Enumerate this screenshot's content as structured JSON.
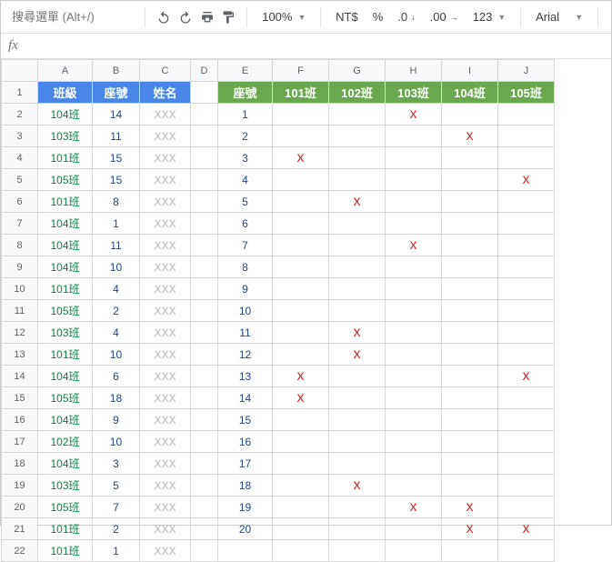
{
  "toolbar": {
    "search_placeholder": "搜尋選單 (Alt+/)",
    "zoom": "100%",
    "currency": "NT$",
    "percent": "%",
    "dec_dec": ".0",
    "dec_inc": ".00",
    "num_fmt": "123",
    "font": "Arial"
  },
  "fx": "fx",
  "cols": [
    "A",
    "B",
    "C",
    "D",
    "E",
    "F",
    "G",
    "H",
    "I",
    "J"
  ],
  "rows": [
    "1",
    "2",
    "3",
    "4",
    "5",
    "6",
    "7",
    "8",
    "9",
    "10",
    "11",
    "12",
    "13",
    "14",
    "15",
    "16",
    "17",
    "18",
    "19",
    "20",
    "21",
    "22"
  ],
  "h1": {
    "a": "班級",
    "b": "座號",
    "c": "姓名",
    "e": "座號",
    "f": "101班",
    "g": "102班",
    "h": "103班",
    "i": "104班",
    "j": "105班"
  },
  "d": [
    {
      "a": "104班",
      "b": "14",
      "c": "XXX",
      "e": "1",
      "f": "",
      "g": "",
      "h": "X",
      "i": "",
      "j": ""
    },
    {
      "a": "103班",
      "b": "11",
      "c": "XXX",
      "e": "2",
      "f": "",
      "g": "",
      "h": "",
      "i": "X",
      "j": ""
    },
    {
      "a": "101班",
      "b": "15",
      "c": "XXX",
      "e": "3",
      "f": "X",
      "g": "",
      "h": "",
      "i": "",
      "j": ""
    },
    {
      "a": "105班",
      "b": "15",
      "c": "XXX",
      "e": "4",
      "f": "",
      "g": "",
      "h": "",
      "i": "",
      "j": "X"
    },
    {
      "a": "101班",
      "b": "8",
      "c": "XXX",
      "e": "5",
      "f": "",
      "g": "X",
      "h": "",
      "i": "",
      "j": ""
    },
    {
      "a": "104班",
      "b": "1",
      "c": "XXX",
      "e": "6",
      "f": "",
      "g": "",
      "h": "",
      "i": "",
      "j": ""
    },
    {
      "a": "104班",
      "b": "11",
      "c": "XXX",
      "e": "7",
      "f": "",
      "g": "",
      "h": "X",
      "i": "",
      "j": ""
    },
    {
      "a": "104班",
      "b": "10",
      "c": "XXX",
      "e": "8",
      "f": "",
      "g": "",
      "h": "",
      "i": "",
      "j": ""
    },
    {
      "a": "101班",
      "b": "4",
      "c": "XXX",
      "e": "9",
      "f": "",
      "g": "",
      "h": "",
      "i": "",
      "j": ""
    },
    {
      "a": "105班",
      "b": "2",
      "c": "XXX",
      "e": "10",
      "f": "",
      "g": "",
      "h": "",
      "i": "",
      "j": ""
    },
    {
      "a": "103班",
      "b": "4",
      "c": "XXX",
      "e": "11",
      "f": "",
      "g": "X",
      "h": "",
      "i": "",
      "j": ""
    },
    {
      "a": "101班",
      "b": "10",
      "c": "XXX",
      "e": "12",
      "f": "",
      "g": "X",
      "h": "",
      "i": "",
      "j": ""
    },
    {
      "a": "104班",
      "b": "6",
      "c": "XXX",
      "e": "13",
      "f": "X",
      "g": "",
      "h": "",
      "i": "",
      "j": "X"
    },
    {
      "a": "105班",
      "b": "18",
      "c": "XXX",
      "e": "14",
      "f": "X",
      "g": "",
      "h": "",
      "i": "",
      "j": ""
    },
    {
      "a": "104班",
      "b": "9",
      "c": "XXX",
      "e": "15",
      "f": "",
      "g": "",
      "h": "",
      "i": "",
      "j": ""
    },
    {
      "a": "102班",
      "b": "10",
      "c": "XXX",
      "e": "16",
      "f": "",
      "g": "",
      "h": "",
      "i": "",
      "j": ""
    },
    {
      "a": "104班",
      "b": "3",
      "c": "XXX",
      "e": "17",
      "f": "",
      "g": "",
      "h": "",
      "i": "",
      "j": ""
    },
    {
      "a": "103班",
      "b": "5",
      "c": "XXX",
      "e": "18",
      "f": "",
      "g": "X",
      "h": "",
      "i": "",
      "j": ""
    },
    {
      "a": "105班",
      "b": "7",
      "c": "XXX",
      "e": "19",
      "f": "",
      "g": "",
      "h": "X",
      "i": "X",
      "j": ""
    },
    {
      "a": "101班",
      "b": "2",
      "c": "XXX",
      "e": "20",
      "f": "",
      "g": "",
      "h": "",
      "i": "X",
      "j": "X"
    },
    {
      "a": "101班",
      "b": "1",
      "c": "XXX",
      "e": "",
      "f": "",
      "g": "",
      "h": "",
      "i": "",
      "j": ""
    }
  ]
}
